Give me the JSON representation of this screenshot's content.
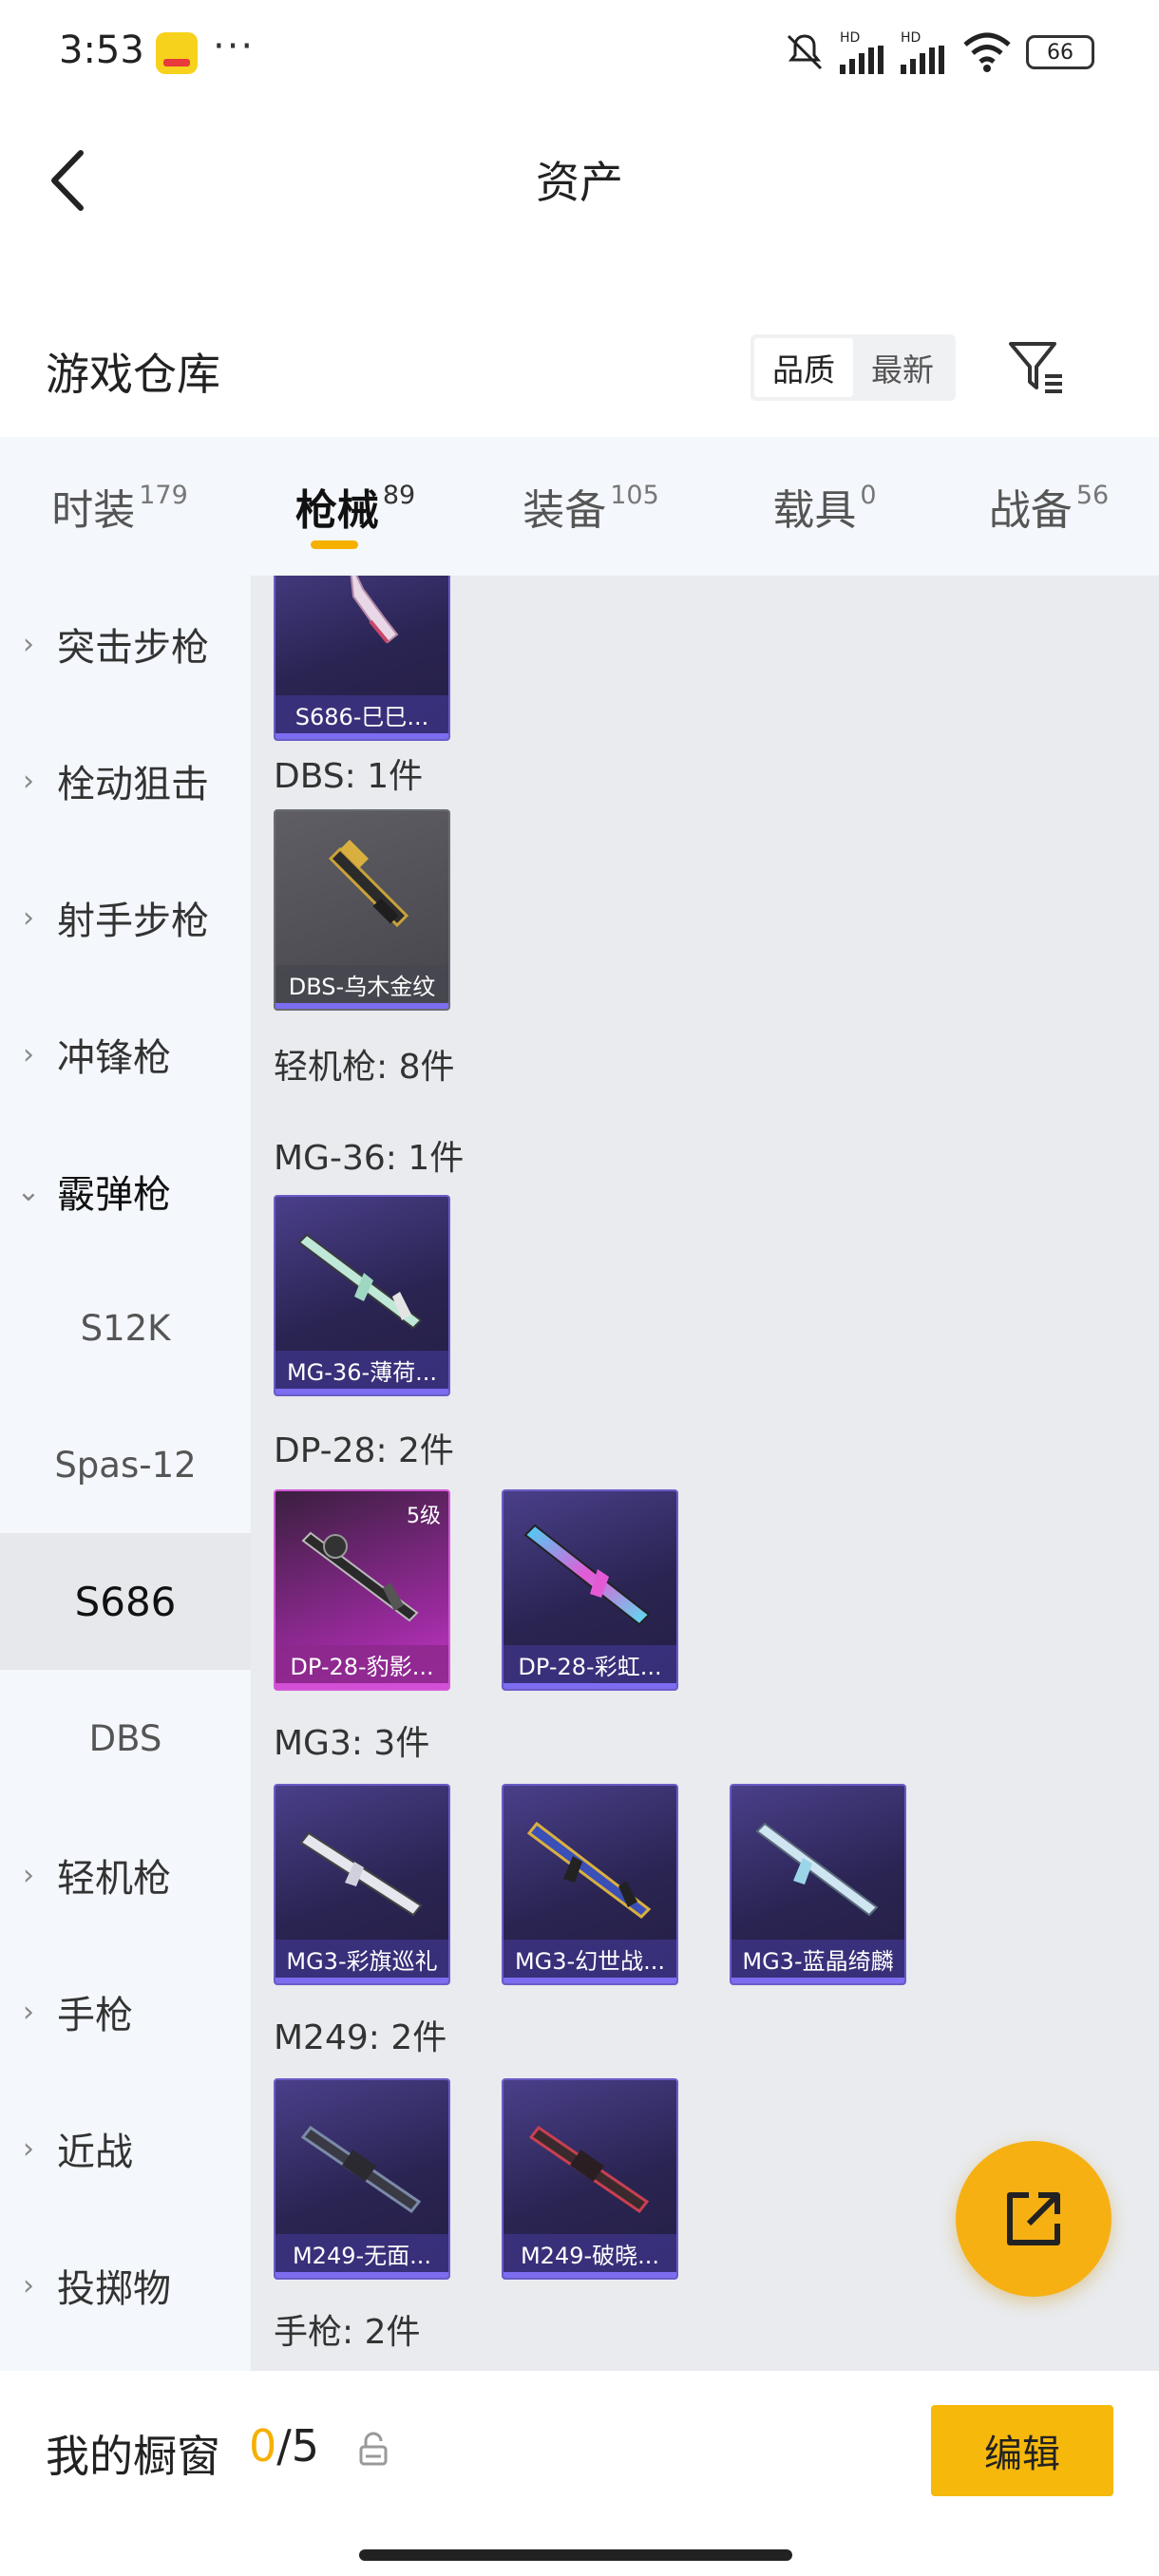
{
  "status_bar": {
    "time": "3:53",
    "dots": "···",
    "battery": "66",
    "signal1_label": "HD",
    "signal2_label": "HD"
  },
  "header": {
    "title": "资产"
  },
  "warehouse": {
    "title": "游戏仓库",
    "sort_options": [
      "品质",
      "最新"
    ],
    "active_sort": 0
  },
  "tabs": [
    {
      "label": "时装",
      "count": "179"
    },
    {
      "label": "枪械",
      "count": "89"
    },
    {
      "label": "装备",
      "count": "105"
    },
    {
      "label": "载具",
      "count": "0"
    },
    {
      "label": "战备",
      "count": "56"
    }
  ],
  "active_tab": 1,
  "sidebar": {
    "items": [
      {
        "label": "突击步枪",
        "type": "category"
      },
      {
        "label": "栓动狙击",
        "type": "category"
      },
      {
        "label": "射手步枪",
        "type": "category"
      },
      {
        "label": "冲锋枪",
        "type": "category"
      },
      {
        "label": "霰弹枪",
        "type": "category-expanded"
      },
      {
        "label": "S12K",
        "type": "sub"
      },
      {
        "label": "Spas-12",
        "type": "sub"
      },
      {
        "label": "S686",
        "type": "sub-selected"
      },
      {
        "label": "DBS",
        "type": "sub"
      },
      {
        "label": "轻机枪",
        "type": "category"
      },
      {
        "label": "手枪",
        "type": "category"
      },
      {
        "label": "近战",
        "type": "category"
      },
      {
        "label": "投掷物",
        "type": "category"
      }
    ]
  },
  "content": {
    "groups": [
      {
        "title": "",
        "cards": [
          {
            "name": "S686-巳巳...",
            "style": "purple"
          }
        ]
      },
      {
        "title": "DBS: 1件",
        "cards": [
          {
            "name": "DBS-乌木金纹",
            "style": "gray"
          }
        ]
      },
      {
        "title": "轻机枪: 8件",
        "cards": []
      },
      {
        "title": "MG-36: 1件",
        "cards": [
          {
            "name": "MG-36-薄荷...",
            "style": "purple"
          }
        ]
      },
      {
        "title": "DP-28: 2件",
        "cards": [
          {
            "name": "DP-28-豹影...",
            "style": "pink",
            "level": "5级"
          },
          {
            "name": "DP-28-彩虹...",
            "style": "purple"
          }
        ]
      },
      {
        "title": "MG3: 3件",
        "cards": [
          {
            "name": "MG3-彩旗巡礼",
            "style": "purple"
          },
          {
            "name": "MG3-幻世战...",
            "style": "purple"
          },
          {
            "name": "MG3-蓝晶绮麟",
            "style": "purple"
          }
        ]
      },
      {
        "title": "M249: 2件",
        "cards": [
          {
            "name": "M249-无面...",
            "style": "purple"
          },
          {
            "name": "M249-破晓...",
            "style": "purple"
          }
        ]
      },
      {
        "title": "手枪: 2件",
        "cards": []
      }
    ]
  },
  "bottom_bar": {
    "label": "我的橱窗",
    "current": "0",
    "total": "/5",
    "edit_label": "编辑"
  },
  "colors": {
    "accent": "#f6b012",
    "card_border": "#6a5cc7",
    "tab_indicator": "#f5b000"
  },
  "icons": {
    "back": "chevron-left-icon",
    "filter": "filter-icon",
    "share": "external-link-icon",
    "lock": "lock-icon"
  }
}
